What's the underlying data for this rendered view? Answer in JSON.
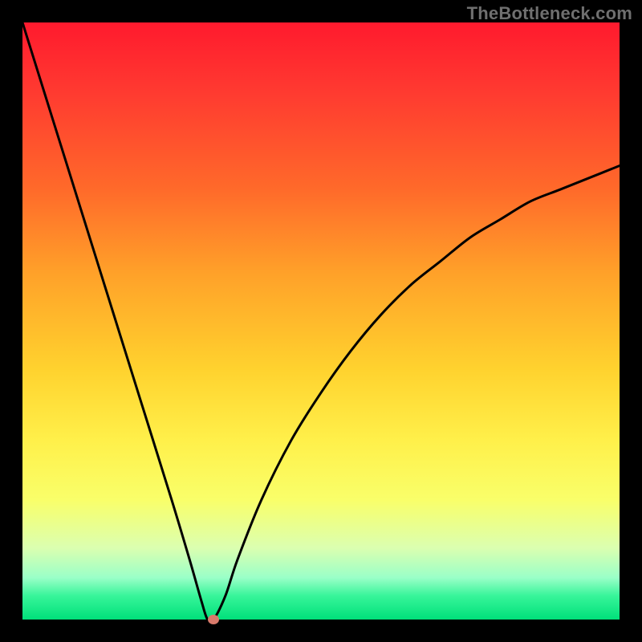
{
  "watermark": "TheBottleneck.com",
  "chart_data": {
    "type": "line",
    "title": "",
    "xlabel": "",
    "ylabel": "",
    "xlim": [
      0,
      100
    ],
    "ylim": [
      0,
      100
    ],
    "grid": false,
    "legend": false,
    "series": [
      {
        "name": "curve",
        "x": [
          0,
          5,
          10,
          15,
          20,
          25,
          28,
          30,
          31,
          32,
          34,
          36,
          40,
          45,
          50,
          55,
          60,
          65,
          70,
          75,
          80,
          85,
          90,
          95,
          100
        ],
        "y": [
          100,
          84,
          68,
          52,
          36,
          20,
          10,
          3,
          0,
          0,
          4,
          10,
          20,
          30,
          38,
          45,
          51,
          56,
          60,
          64,
          67,
          70,
          72,
          74,
          76
        ]
      }
    ],
    "marker": {
      "x": 32,
      "y": 0,
      "color": "#d97a6b"
    },
    "background_gradient": {
      "top": "#ff1a2e",
      "mid": "#fff04a",
      "bottom": "#00e07a"
    }
  }
}
